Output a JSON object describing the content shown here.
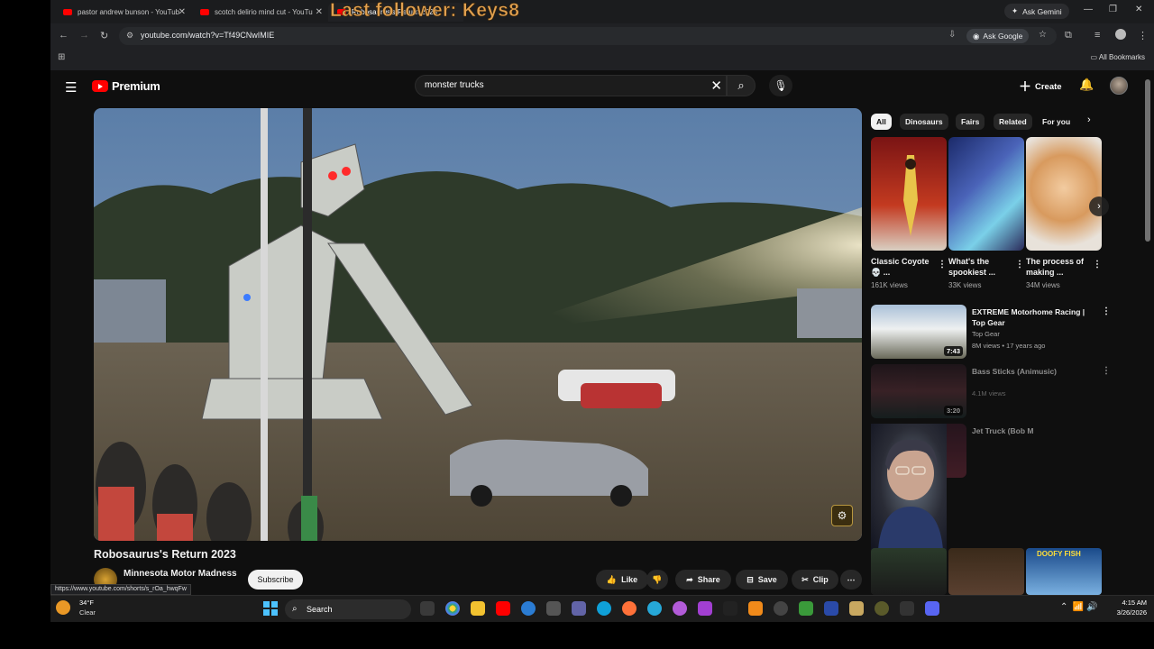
{
  "stream_overlay": {
    "text": "Last follower: Keys8"
  },
  "browser": {
    "tabs": [
      {
        "title": "pastor andrew bunson - YouTub"
      },
      {
        "title": "scotch delirio mind cut - YouTu"
      },
      {
        "title": "Robosaurus's Return 2023"
      }
    ],
    "ask_gemini": "Ask Gemini",
    "url": "youtube.com/watch?v=Tf49CNwIMIE",
    "ask_google": "Ask Google",
    "all_bookmarks": "All Bookmarks",
    "status_url": "https://www.youtube.com/shorts/s_rOa_hwqFw"
  },
  "youtube": {
    "logo_text": "Premium",
    "search_value": "monster trucks",
    "create_label": "Create",
    "video_title": "Robosaurus's Return 2023",
    "channel_name": "Minnesota Motor Madness",
    "subscribe_label": "Subscribe",
    "actions": {
      "like": "Like",
      "share": "Share",
      "save": "Save",
      "clip": "Clip"
    },
    "chips": [
      "All",
      "Dinosaurs",
      "Fairs",
      "Related",
      "For you"
    ],
    "shorts": [
      {
        "title": "Classic Coyote 💀 ...",
        "views": "161K views"
      },
      {
        "title": "What's the spookiest ...",
        "views": "33K views"
      },
      {
        "title": "The process of making ...",
        "views": "34M views"
      }
    ],
    "recommendations": [
      {
        "title": "EXTREME Motorhome Racing | Top Gear",
        "channel": "Top Gear",
        "meta": "8M views • 17 years ago",
        "duration": "7:43"
      },
      {
        "title": "Bass Sticks (Animusic)",
        "channel": "",
        "meta": "4.1M views",
        "duration": "3:20"
      },
      {
        "title": "Jet Truck (Bob M",
        "channel": "",
        "meta": "",
        "duration": ""
      }
    ],
    "bottom_thumb_text": "DOOFY FISH"
  },
  "taskbar": {
    "temperature": "34°F",
    "condition": "Clear",
    "search_label": "Search",
    "time": "4:15 AM",
    "date": "3/26/2026"
  }
}
